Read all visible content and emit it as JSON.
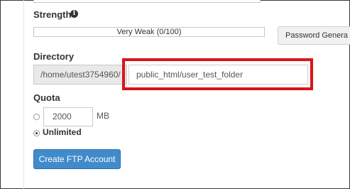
{
  "strength": {
    "label": "Strength",
    "info_icon": "info-circle-icon",
    "meter_text": "Very Weak (0/100)",
    "meter_value": 0,
    "generator_label": "Password Genera"
  },
  "directory": {
    "label": "Directory",
    "prefix": "/home/utest3754960/",
    "value": "public_html/user_test_folder",
    "highlight_color": "#d9141b"
  },
  "quota": {
    "label": "Quota",
    "limited_value": "2000",
    "unit": "MB",
    "unlimited_label": "Unlimited",
    "selected": "unlimited"
  },
  "actions": {
    "create_label": "Create FTP Account",
    "create_color": "#428bca"
  }
}
